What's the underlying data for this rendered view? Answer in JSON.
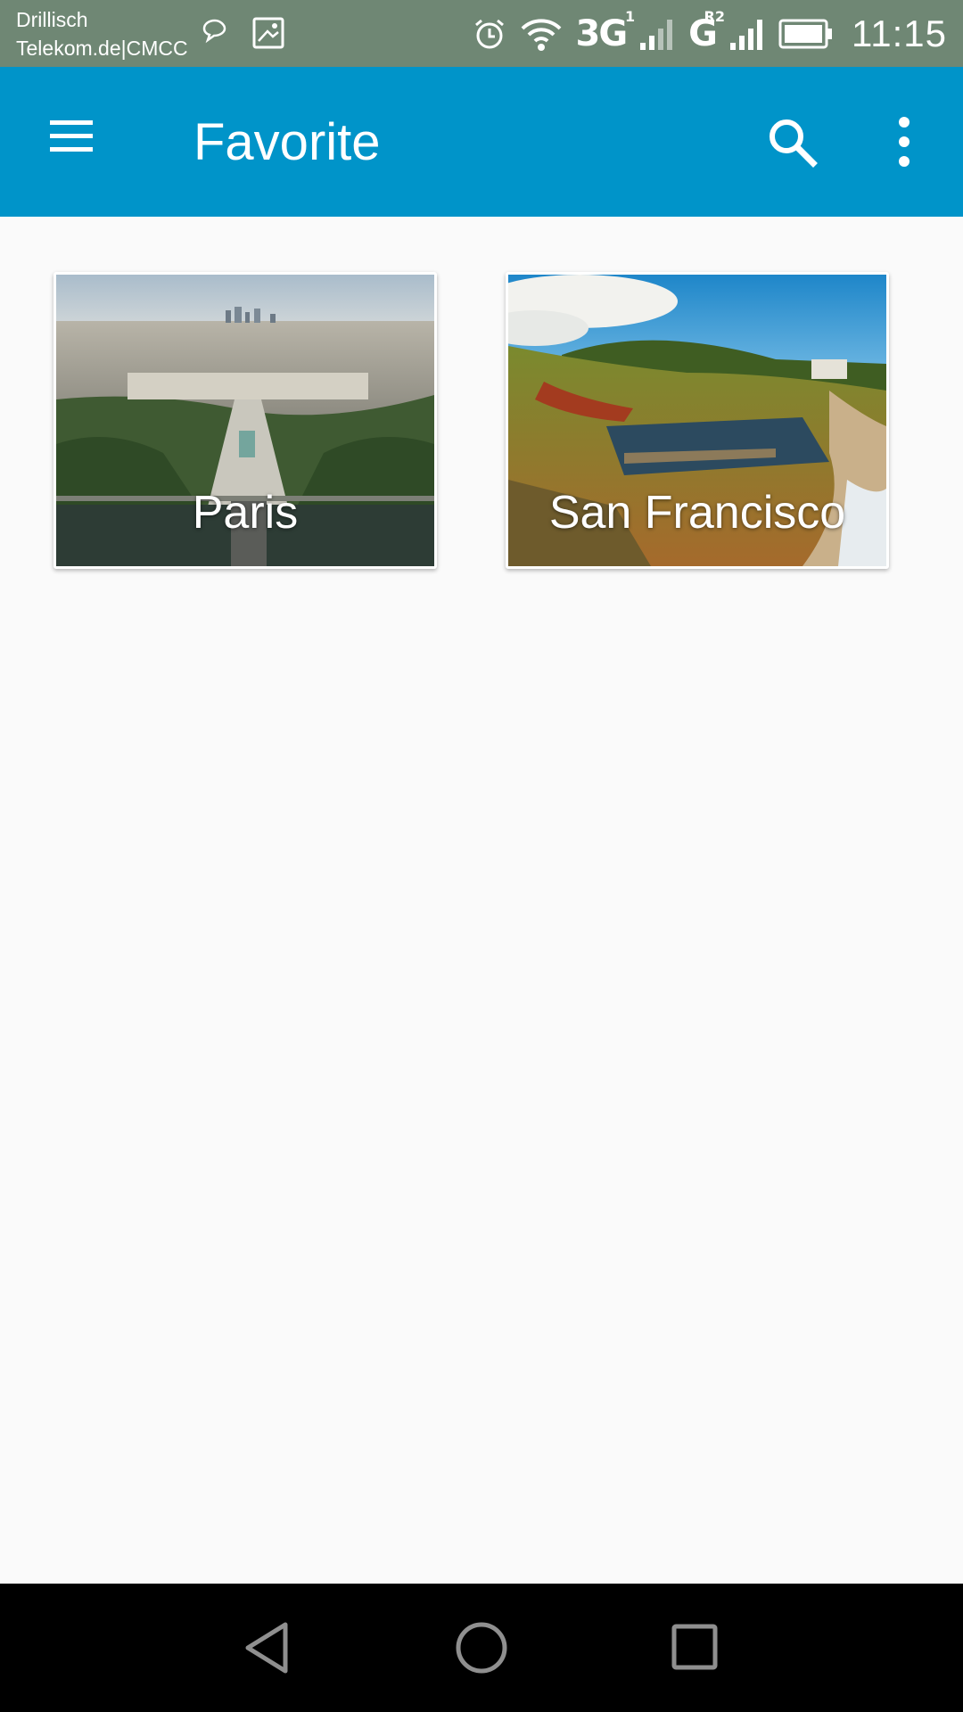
{
  "status_bar": {
    "carrier_line1": "Drillisch",
    "carrier_line2": "Telekom.de|CMCC",
    "network1": "3G",
    "network1_sim": "1",
    "network2": "G",
    "network2_sim": "R2",
    "time": "11:15",
    "icons": [
      "chat-bubble-icon",
      "image-icon",
      "alarm-icon",
      "wifi-icon",
      "signal-icon",
      "battery-icon"
    ]
  },
  "app_bar": {
    "title": "Favorite",
    "color": "#0094c9",
    "icons": [
      "menu-icon",
      "search-icon",
      "more-vert-icon"
    ]
  },
  "favorites": [
    {
      "label": "Paris"
    },
    {
      "label": "San Francisco"
    }
  ],
  "nav_bar": {
    "icons": [
      "back-icon",
      "home-icon",
      "recent-apps-icon"
    ]
  }
}
